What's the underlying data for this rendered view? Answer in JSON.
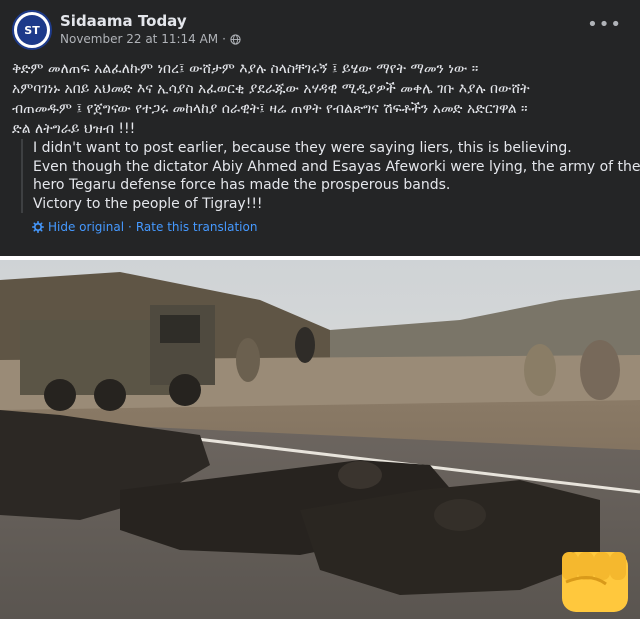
{
  "post": {
    "author": "Sidaama Today",
    "avatar_text": "ST",
    "timestamp": "November 22 at 11:14 AM",
    "separator": "·",
    "more_label": "•••",
    "amharic_lines": [
      "ቅድም መለጠፍ አልፈለኩም ነበረ፤ ውሸታም እያሉ ስላስቸገሩኝ ፤ ይሄው ማየት ማመን ነው ።",
      "አምባገነኑ አበይ አህመድ እና ኢሳያስ አፈወርቂ ያደራጁው አሃዳዊ ሚዲያዎች መቀሌ ገቡ እያሉ በውሸት",
      "ብጠመዱም ፤ የጀግናው የተጋሩ መከላከያ ሰራዊት፤ ዛሬ ጠዋት የብልጽግና ሽፍቶችን አመድ አድርገዋል ።",
      "ድል ለትግራይ ህዝብ !!!"
    ],
    "translation_lines": [
      "I didn't want to post earlier, because they were saying liers, this is believing.",
      "Even though the dictator Abiy Ahmed and Esayas Afeworki were lying, the army of the",
      "hero Tegaru defense force has made the prosperous bands.",
      "Victory to the people of Tigray!!!"
    ],
    "hide_original": "Hide original",
    "rate_translation": "Rate this translation",
    "link_separator": "·"
  },
  "icons": {
    "privacy": "globe-icon",
    "settings": "gear-icon",
    "reaction": "raised-fist-emoji"
  },
  "colors": {
    "post_bg": "#242526",
    "text_primary": "#e4e6eb",
    "text_secondary": "#b0b3b8",
    "link": "#4599ff",
    "avatar_brand": "#1d3a8a",
    "emoji_yellow": "#ffc83d"
  }
}
